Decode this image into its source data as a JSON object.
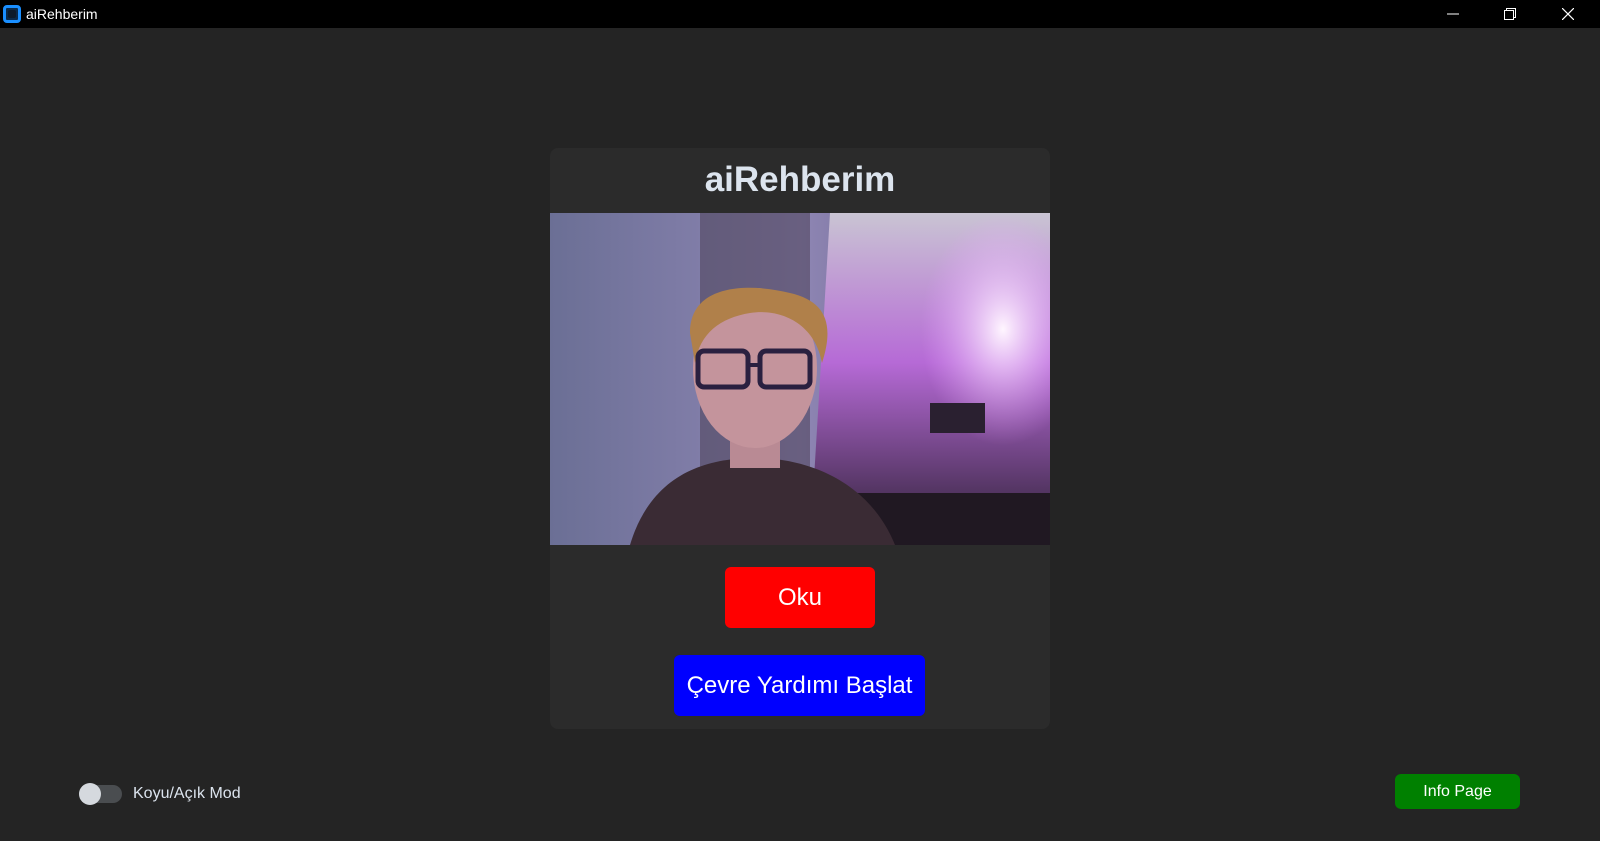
{
  "window": {
    "title": "aiRehberim"
  },
  "card": {
    "title": "aiRehberim",
    "camera_feed_desc_icon": "camera-feed",
    "read_button_label": "Oku",
    "environment_button_label": "Çevre Yardımı Başlat"
  },
  "footer": {
    "mode_toggle_label": "Koyu/Açık Mod",
    "mode_toggle_on": false,
    "info_button_label": "Info Page"
  },
  "colors": {
    "background": "#242424",
    "card": "#2b2b2b",
    "read_button": "#ff0000",
    "environment_button": "#0000ff",
    "info_button": "#008000",
    "title_text": "#dce4ee"
  }
}
